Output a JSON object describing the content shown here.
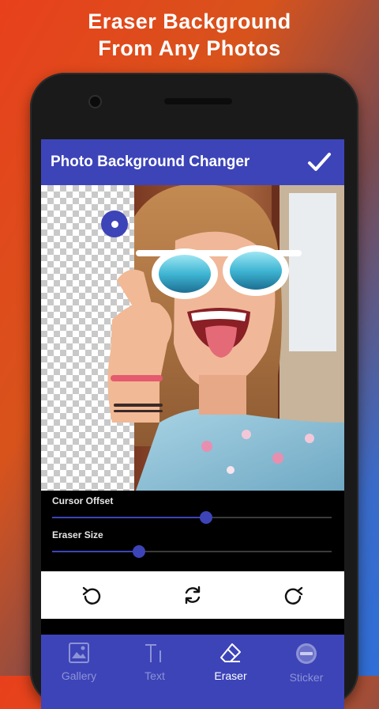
{
  "promo": {
    "line1": "Eraser Background",
    "line2": "From Any Photos"
  },
  "app": {
    "title": "Photo Background Changer",
    "confirm_icon": "checkmark-icon"
  },
  "controls": {
    "cursor_offset_label": "Cursor Offset",
    "cursor_offset_value": 0.55,
    "eraser_size_label": "Eraser Size",
    "eraser_size_value": 0.31
  },
  "actions": [
    {
      "name": "undo",
      "icon": "undo-icon"
    },
    {
      "name": "reset",
      "icon": "refresh-icon"
    },
    {
      "name": "redo",
      "icon": "redo-icon"
    }
  ],
  "nav": {
    "gallery": "Gallery",
    "text": "Text",
    "eraser": "Eraser",
    "sticker": "Sticker",
    "active": "Eraser"
  },
  "colors": {
    "accent": "#3d44b8",
    "inactive_nav": "#8d93d6"
  }
}
